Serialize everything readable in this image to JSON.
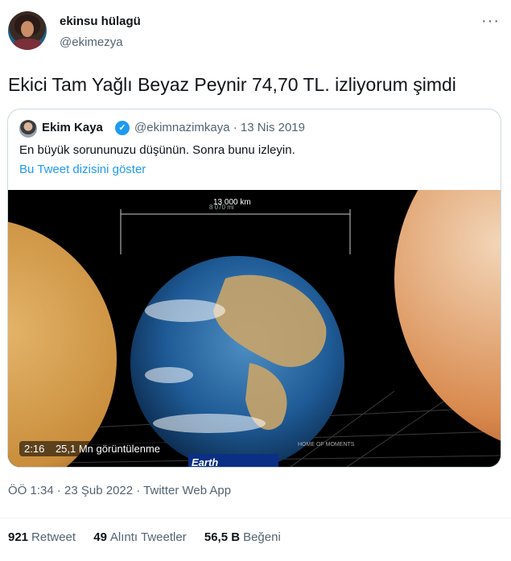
{
  "author": {
    "name": "ekinsu hülagü",
    "handle": "@ekimezya"
  },
  "menu_icon": "more-horizontal-icon",
  "tweet": {
    "text": "Ekici Tam Yağlı Beyaz Peynir 74,70 TL. izliyorum şimdi"
  },
  "quoted": {
    "name": "Ekim Kaya",
    "verified_icon": "verified-badge-icon",
    "handle_date": "@ekimnazimkaya · 13 Nis 2019",
    "text": "En büyük sorununuzu düşünün. Sonra bunu izleyin.",
    "thread_link": "Bu Tweet dizisini göster",
    "video": {
      "duration": "2:16",
      "views": "25,1 Mn görüntülenme",
      "scale_label_top": "8 070 mi",
      "scale_label": "13 000 km",
      "planet_caption": "Earth",
      "watermark": "HOME OF MOMENTS"
    }
  },
  "meta": "ÖÖ 1:34 · 23 Şub 2022 · Twitter Web App",
  "stats": {
    "retweets": "921",
    "retweets_label": "Retweet",
    "quotes": "49",
    "quotes_label": "Alıntı Tweetler",
    "likes": "56,5 B",
    "likes_label": "Beğeni"
  }
}
